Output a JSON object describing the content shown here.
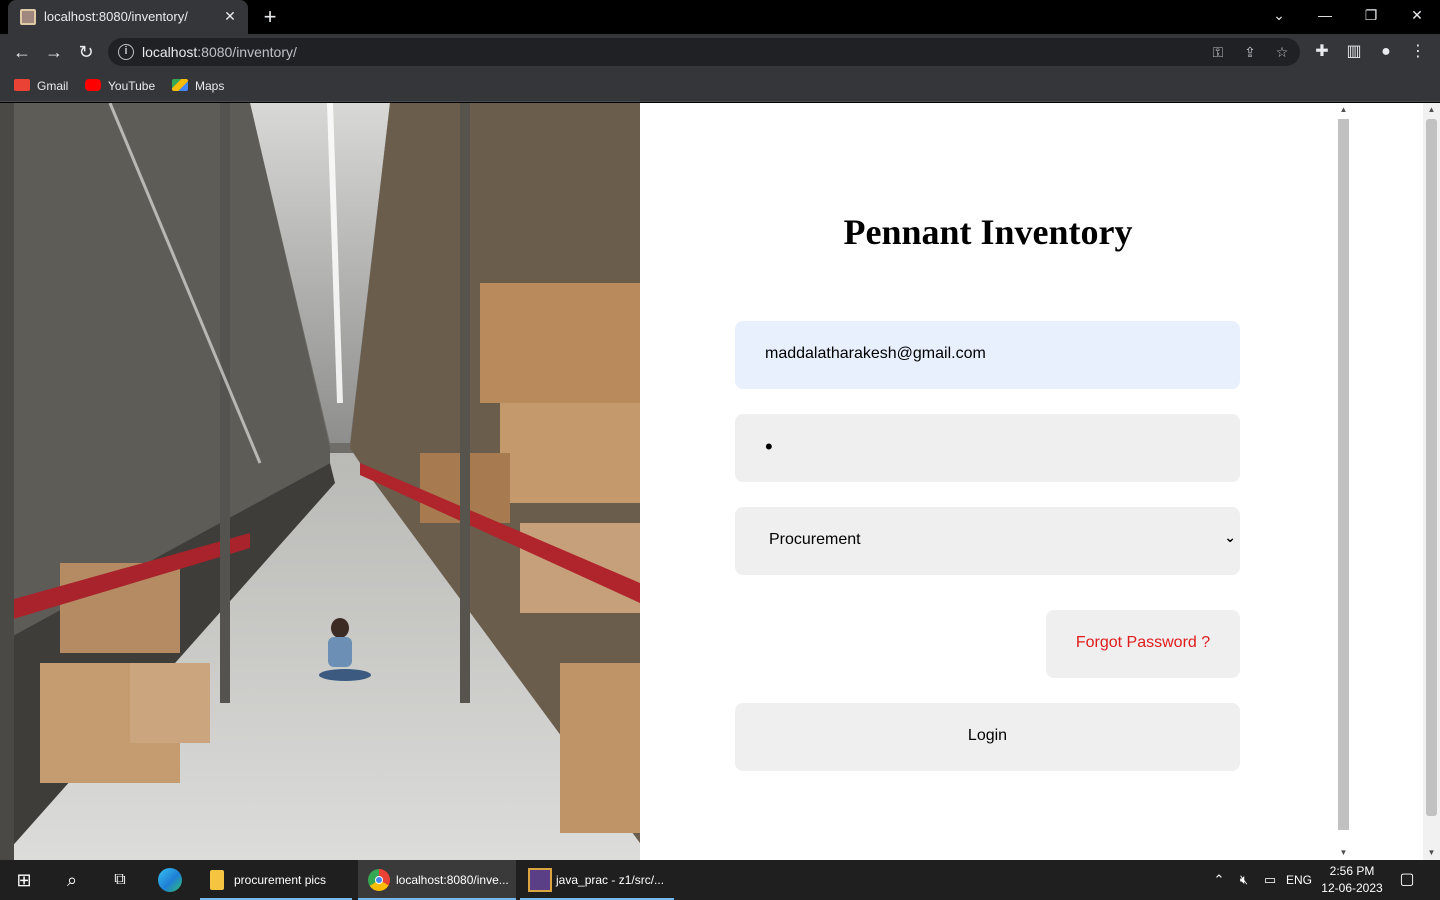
{
  "browser": {
    "tab_title": "localhost:8080/inventory/",
    "url_host": "localhost",
    "url_rest": ":8080/inventory/",
    "bookmarks": [
      "Gmail",
      "YouTube",
      "Maps"
    ]
  },
  "page": {
    "title": "Pennant Inventory",
    "email_value": "maddalatharakesh@gmail.com",
    "password_mask": "•",
    "role_selected": "Procurement",
    "forgot_label": "Forgot Password ?",
    "login_label": "Login"
  },
  "taskbar": {
    "apps": [
      "procurement pics",
      "localhost:8080/inve...",
      "java_prac - z1/src/..."
    ],
    "lang": "ENG",
    "time": "2:56 PM",
    "date": "12-06-2023"
  },
  "colors": {
    "email_bg": "#e8f0fe",
    "field_bg": "#efefef",
    "forgot_text": "#e01b1b"
  }
}
